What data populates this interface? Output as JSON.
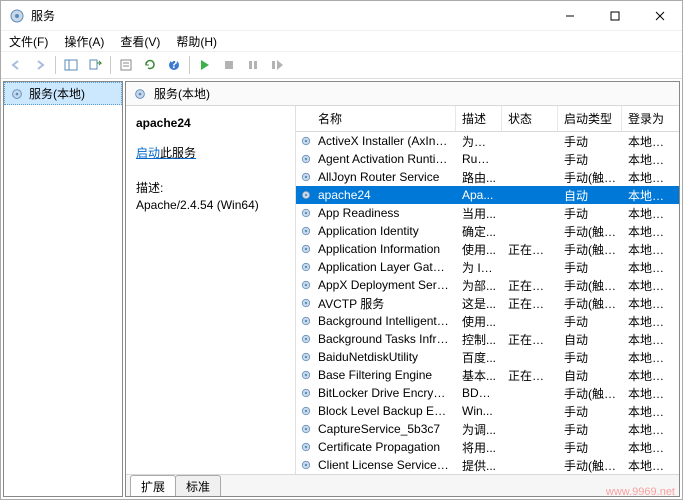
{
  "window": {
    "title": "服务"
  },
  "menus": {
    "file": "文件(F)",
    "action": "操作(A)",
    "view": "查看(V)",
    "help": "帮助(H)"
  },
  "tree": {
    "root": "服务(本地)"
  },
  "main_header": "服务(本地)",
  "detail": {
    "selected_title": "apache24",
    "start_prefix": "启动",
    "start_suffix": "此服务",
    "desc_label": "描述:",
    "desc_value": "Apache/2.4.54 (Win64)"
  },
  "columns": {
    "name": "名称",
    "desc": "描述",
    "status": "状态",
    "startup": "启动类型",
    "logon": "登录为"
  },
  "services": [
    {
      "name": "ActiveX Installer (AxInstSV)",
      "desc": "为从 ...",
      "status": "",
      "startup": "手动",
      "logon": "本地系统"
    },
    {
      "name": "Agent Activation Runtime...",
      "desc": "Runt...",
      "status": "",
      "startup": "手动",
      "logon": "本地系统"
    },
    {
      "name": "AllJoyn Router Service",
      "desc": "路由...",
      "status": "",
      "startup": "手动(触发...",
      "logon": "本地服务"
    },
    {
      "name": "apache24",
      "desc": "Apa...",
      "status": "",
      "startup": "自动",
      "logon": "本地系统",
      "selected": true
    },
    {
      "name": "App Readiness",
      "desc": "当用...",
      "status": "",
      "startup": "手动",
      "logon": "本地系统"
    },
    {
      "name": "Application Identity",
      "desc": "确定...",
      "status": "",
      "startup": "手动(触发...",
      "logon": "本地服务"
    },
    {
      "name": "Application Information",
      "desc": "使用...",
      "status": "正在运行",
      "startup": "手动(触发...",
      "logon": "本地系统"
    },
    {
      "name": "Application Layer Gatewa...",
      "desc": "为 In...",
      "status": "",
      "startup": "手动",
      "logon": "本地服务"
    },
    {
      "name": "AppX Deployment Servic...",
      "desc": "为部...",
      "status": "正在运行",
      "startup": "手动(触发...",
      "logon": "本地系统"
    },
    {
      "name": "AVCTP 服务",
      "desc": "这是...",
      "status": "正在运行",
      "startup": "手动(触发...",
      "logon": "本地服务"
    },
    {
      "name": "Background Intelligent T...",
      "desc": "使用...",
      "status": "",
      "startup": "手动",
      "logon": "本地系统"
    },
    {
      "name": "Background Tasks Infras...",
      "desc": "控制...",
      "status": "正在运行",
      "startup": "自动",
      "logon": "本地系统"
    },
    {
      "name": "BaiduNetdiskUtility",
      "desc": "百度...",
      "status": "",
      "startup": "手动",
      "logon": "本地系统"
    },
    {
      "name": "Base Filtering Engine",
      "desc": "基本...",
      "status": "正在运行",
      "startup": "自动",
      "logon": "本地服务"
    },
    {
      "name": "BitLocker Drive Encryptio...",
      "desc": "BDE...",
      "status": "",
      "startup": "手动(触发...",
      "logon": "本地系统"
    },
    {
      "name": "Block Level Backup Engi...",
      "desc": "Win...",
      "status": "",
      "startup": "手动",
      "logon": "本地系统"
    },
    {
      "name": "CaptureService_5b3c7",
      "desc": "为调...",
      "status": "",
      "startup": "手动",
      "logon": "本地系统"
    },
    {
      "name": "Certificate Propagation",
      "desc": "将用...",
      "status": "",
      "startup": "手动",
      "logon": "本地系统"
    },
    {
      "name": "Client License Service (Cli...",
      "desc": "提供...",
      "status": "",
      "startup": "手动(触发...",
      "logon": "本地系统"
    }
  ],
  "tabs": {
    "extended": "扩展",
    "standard": "标准"
  },
  "watermark": "www.9969.net"
}
